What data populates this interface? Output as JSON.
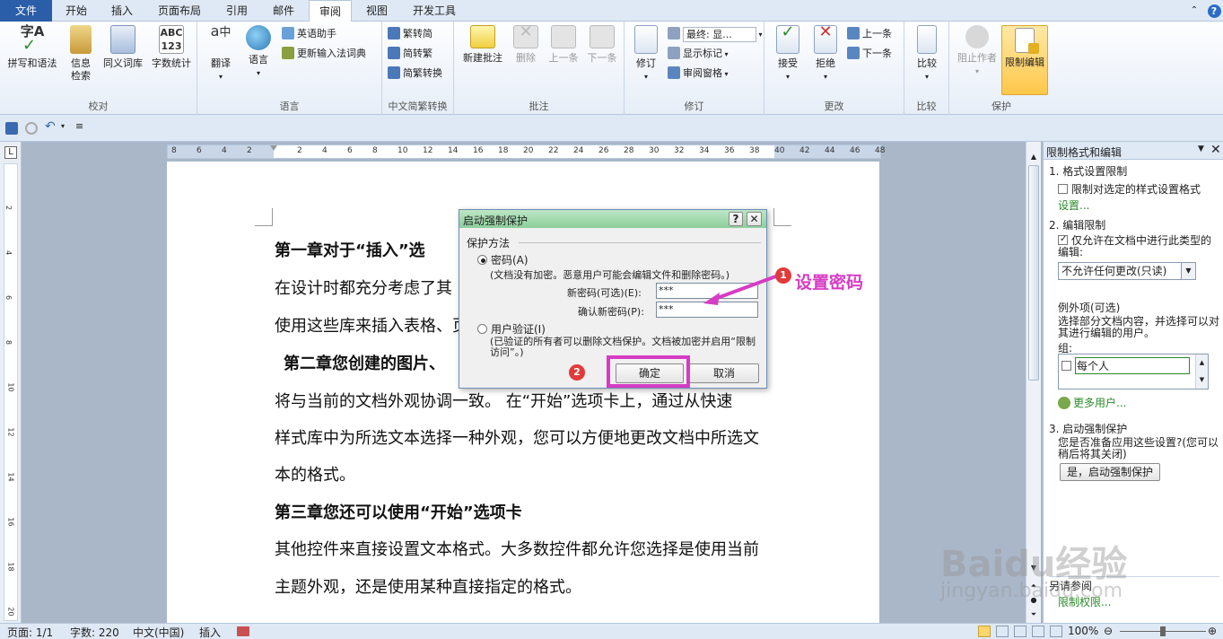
{
  "tabs": {
    "file": "文件",
    "home": "开始",
    "insert": "插入",
    "layout": "页面布局",
    "references": "引用",
    "mailings": "邮件",
    "review": "审阅",
    "view": "视图",
    "developer": "开发工具"
  },
  "ribbon": {
    "proofing": {
      "label": "校对",
      "spelling": "拼写和语法",
      "research": "信息\n检索",
      "thesaurus": "同义词库",
      "wordcount": "字数统计"
    },
    "language": {
      "label": "语言",
      "translate": "翻译",
      "lang": "语言",
      "english_assistant": "英语助手",
      "update_ime": "更新输入法词典"
    },
    "chinese": {
      "label": "中文简繁转换",
      "to_simplified": "繁转简",
      "to_traditional": "简转繁",
      "convert": "简繁转换"
    },
    "comments": {
      "label": "批注",
      "new": "新建批注",
      "delete": "删除",
      "prev": "上一条",
      "next": "下一条"
    },
    "tracking": {
      "label": "修订",
      "track": "修订",
      "final": "最终: 显...",
      "show_markup": "显示标记",
      "pane": "审阅窗格"
    },
    "changes": {
      "label": "更改",
      "accept": "接受",
      "reject": "拒绝",
      "prev": "上一条",
      "next": "下一条"
    },
    "compare": {
      "label": "比较",
      "compare": "比较"
    },
    "protect": {
      "label": "保护",
      "block_authors": "阻止作者",
      "restrict": "限制编辑"
    }
  },
  "ruler": {
    "h_left": [
      "8",
      "6",
      "4",
      "2"
    ],
    "h_right": [
      "2",
      "4",
      "6",
      "8",
      "10",
      "12",
      "14",
      "16",
      "18",
      "20",
      "22",
      "24",
      "26",
      "28",
      "30",
      "32",
      "34",
      "36",
      "38",
      "40",
      "42",
      "44",
      "46",
      "48"
    ],
    "v": [
      "2",
      "4",
      "6",
      "8",
      "10",
      "12",
      "14",
      "16",
      "18",
      "20"
    ]
  },
  "document": {
    "line1": "第一章对于“插入”选",
    "line2": "在设计时都充分考虑了其",
    "line3": "使用这些库来插入表格、页",
    "line4": "第二章您创建的图片、",
    "line5": "将与当前的文档外观协调一致。 在“开始”选项卡上，通过从快速",
    "line6": "样式库中为所选文本选择一种外观，您可以方便地更改文档中所选文",
    "line7": "本的格式。",
    "line8": "第三章您还可以使用“开始”选项卡",
    "line9": "其他控件来直接设置文本格式。大多数控件都允许您选择是使用当前",
    "line10": "主题外观，还是使用某种直接指定的格式。"
  },
  "dialog": {
    "title": "启动强制保护",
    "help": "?",
    "close": "✕",
    "method_label": "保护方法",
    "password_radio": "密码(A)",
    "password_note": "(文档没有加密。恶意用户可能会编辑文件和删除密码。)",
    "new_pwd_label": "新密码(可选)(E):",
    "new_pwd_value": "***",
    "confirm_pwd_label": "确认新密码(P):",
    "confirm_pwd_value": "***",
    "user_auth_radio": "用户验证(I)",
    "user_auth_note": "(已验证的所有者可以删除文档保护。文档被加密并启用“限制访问”。)",
    "ok": "确定",
    "cancel": "取消"
  },
  "annotations": {
    "badge1": "1",
    "text1": "设置密码",
    "badge2": "2"
  },
  "panel": {
    "title": "限制格式和编辑",
    "s1_title": "1. 格式设置限制",
    "s1_check": "限制对选定的样式设置格式",
    "s1_link": "设置...",
    "s2_title": "2. 编辑限制",
    "s2_check": "仅允许在文档中进行此类型的编辑:",
    "s2_select": "不允许任何更改(只读)",
    "exceptions_title": "例外项(可选)",
    "exceptions_desc": "选择部分文档内容，并选择可以对其进行编辑的用户。",
    "groups_label": "组:",
    "group_everyone": "每个人",
    "more_users": "更多用户...",
    "s3_title": "3. 启动强制保护",
    "s3_desc": "您是否准备应用这些设置?(您可以稍后将其关闭)",
    "s3_button": "是，启动强制保护",
    "see_also": "另请参阅",
    "see_also_link": "限制权限..."
  },
  "status": {
    "page": "页面: 1/1",
    "words": "字数: 220",
    "lang": "中文(中国)",
    "mode": "插入",
    "zoom": "100%"
  },
  "watermark": {
    "brand": "Baidu经验",
    "url": "jingyan.baidu.com"
  }
}
